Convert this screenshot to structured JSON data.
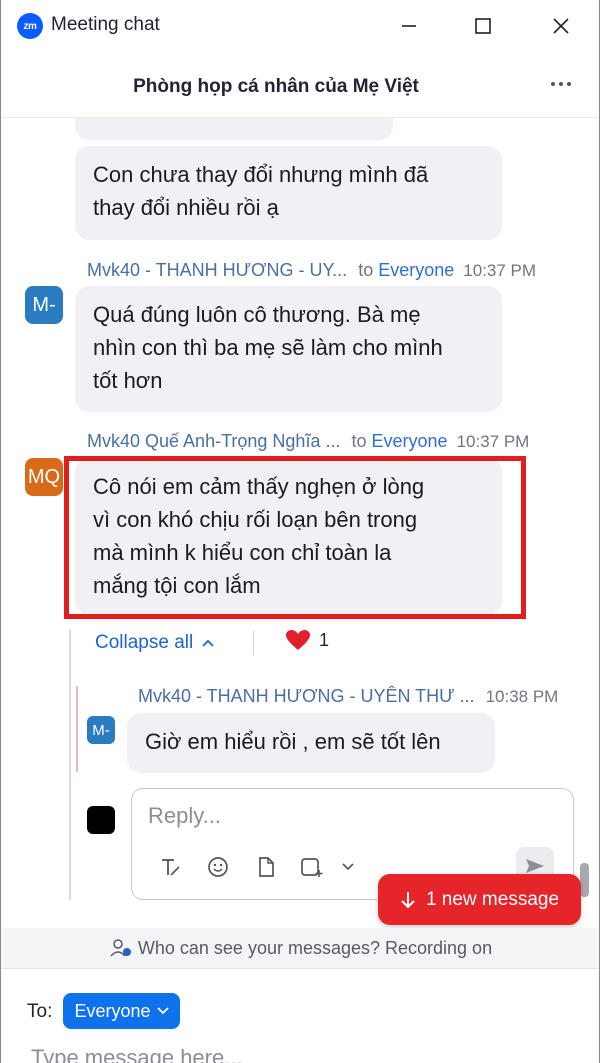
{
  "window": {
    "app_logo": "zm",
    "title": "Meeting chat"
  },
  "header": {
    "title": "Phòng họp cá nhân của Mẹ Việt"
  },
  "messages": [
    {
      "text": "Con chưa thay đổi nhưng mình đã thay đổi nhiều rồi ạ",
      "lines": [
        "Con chưa thay đổi nhưng mình đã",
        "thay đổi nhiều rồi ạ"
      ]
    },
    {
      "sender": "Mvk40 - THANH HƯƠNG - UY...",
      "to": "to",
      "recipient": "Everyone",
      "time": "10:37 PM",
      "avatar": "M-",
      "lines": [
        "Quá đúng luôn cô thương. Bà mẹ",
        "nhìn con thì ba mẹ sẽ làm cho mình",
        "tốt hơn"
      ]
    },
    {
      "sender": "Mvk40 Quế Anh-Trọng Nghĩa ...",
      "to": "to",
      "recipient": "Everyone",
      "time": "10:37 PM",
      "avatar": "MQ",
      "lines": [
        "Cô nói em cảm thấy nghẹn ở lòng",
        "vì con khó chịu rối loạn bên trong",
        "mà mình k hiểu con chỉ toàn la",
        "mắng tội con lắm"
      ]
    }
  ],
  "thread": {
    "collapse_label": "Collapse all",
    "reaction_count": "1",
    "reply": {
      "sender": "Mvk40 - THANH HƯƠNG - UYÊN THƯ ...",
      "time": "10:38 PM",
      "avatar": "M-",
      "text": "Giờ em hiểu rồi , em sẽ tốt lên"
    },
    "reply_placeholder": "Reply..."
  },
  "new_message_button": "1 new message",
  "notice": "Who can see your messages? Recording on",
  "compose": {
    "to_label": "To:",
    "recipient": "Everyone",
    "placeholder": "Type message here..."
  },
  "colors": {
    "accent": "#0e72ed",
    "highlight": "#e11d1d",
    "new_message": "#e5252a"
  }
}
